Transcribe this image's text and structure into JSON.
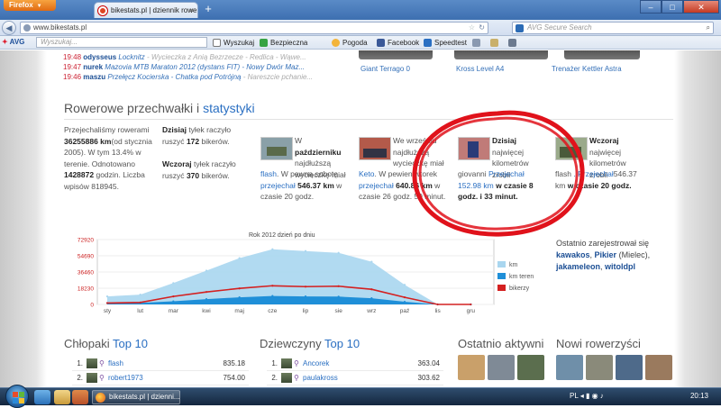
{
  "browser": {
    "menu_label": "Firefox",
    "tab_title": "bikestats.pl | dziennik rowerowy, blogi - ...",
    "url": "www.bikestats.pl",
    "search_placeholder": "AVG Secure Search",
    "new_tab_symbol": "+"
  },
  "toolbar": {
    "avg_label": "AVG",
    "search_placeholder": "Wyszukaj...",
    "items": [
      {
        "label": "Wyszukaj",
        "color": "#2d5ea8"
      },
      {
        "label": "Bezpieczna",
        "color": "#37a343"
      },
      {
        "label": "Pogoda",
        "color": "#f3b43a"
      },
      {
        "label": "Facebook",
        "color": "#3b5998"
      },
      {
        "label": "Speedtest",
        "color": "#2a6fc2"
      }
    ]
  },
  "activity": [
    {
      "time": "19:48",
      "user": "odysseus",
      "title": "Locknitz",
      "extra": "Wycieczka z Anią Bezrzecze - Redlica - Wąwe..."
    },
    {
      "time": "19:47",
      "user": "nurek",
      "title": "Mazovia MTB Maraton 2012 (dystans FIT) - Nowy Dwór Maz...",
      "extra": ""
    },
    {
      "time": "19:46",
      "user": "maszu",
      "title": "Przełęcz Kocierska - Chatka pod Potrójną",
      "extra": "Nareszcie pchanie..."
    }
  ],
  "top_bikes": [
    "Giant Terrago 0",
    "Kross Level A4",
    "Trenażer Kettler Astra"
  ],
  "section": {
    "title_prefix": "Rowerowe przechwałki i ",
    "title_link": "statystyki"
  },
  "stats": {
    "intro": [
      "Przejechaliśmy rowerami",
      "36255886 km",
      "(od stycznia 2005). W tym 13.4% w terenie. Odnotowano",
      "1428872",
      "godzin. Liczba wpisów 818945."
    ],
    "today_tile": [
      "Dzisiaj",
      "tyłek raczyło ruszyć",
      "172",
      "bikerów."
    ],
    "yesterday_tile": [
      "Wczoraj",
      "tyłek raczyło ruszyć",
      "370",
      "bikerów."
    ],
    "october": [
      "W",
      "październiku",
      "najdłuższą wycieczkę miał",
      "flash",
      ". W pewną sobotę",
      "przejechał",
      "546.37 km",
      "w czasie 20 godz."
    ],
    "week": [
      "We wrześniu",
      "najdłuższą wycieczkę miał",
      "Keto",
      ". W pewien wtorek",
      "przejechał",
      "640.86 km",
      "w czasie 26 godz. 50 minut."
    ],
    "today_longest": [
      "Dzisiaj",
      "najwięcej kilometrów zrobił",
      "giovanni",
      "Przejechał",
      "152.98 km",
      "w czasie 8 godz. i 33 minut."
    ],
    "yesterday_longest": [
      "Wczoraj",
      "najwięcej kilometrów zrobił",
      "flash",
      ". Przejechał",
      "546.37 km",
      "w czasie 20 godz."
    ]
  },
  "recent_registered": {
    "text": "Ostatnio zarejestrował się",
    "users": [
      "kawakos",
      "Pikier",
      "(Mielec),",
      "jakameleon",
      "witoldpl"
    ]
  },
  "chart_data": {
    "type": "area",
    "title": "Rok 2012 dzień po dniu",
    "categories": [
      "sty",
      "lut",
      "mar",
      "kwi",
      "maj",
      "cze",
      "lip",
      "sie",
      "wrz",
      "paź",
      "lis",
      "gru"
    ],
    "yticks": [
      0,
      18230,
      36460,
      54690,
      72920
    ],
    "ylim": [
      0,
      72920
    ],
    "series": [
      {
        "name": "km",
        "color": "#a9d6ef",
        "values": [
          9000,
          11000,
          24000,
          38000,
          52000,
          62000,
          60000,
          58000,
          48000,
          22000,
          0,
          0
        ]
      },
      {
        "name": "km teren",
        "color": "#1f8fd8",
        "values": [
          1500,
          1800,
          3500,
          6000,
          8000,
          9500,
          9000,
          8800,
          7000,
          3000,
          0,
          0
        ]
      },
      {
        "name": "bikerzy",
        "color": "#d42020",
        "values": [
          1600,
          2200,
          9000,
          14000,
          18000,
          21000,
          20000,
          20500,
          17000,
          8000,
          0,
          0
        ]
      }
    ],
    "legend_position": "right"
  },
  "bottom": {
    "boys_prefix": "Chłopaki ",
    "boys_link": "Top 10",
    "girls_prefix": "Dziewczyny ",
    "girls_link": "Top 10",
    "active": "Ostatnio aktywni",
    "new_riders": "Nowi rowerzyści",
    "boys": [
      {
        "rank": "1.",
        "name": "flash",
        "km": "835.18"
      },
      {
        "rank": "2.",
        "name": "robert1973",
        "km": "754.00"
      }
    ],
    "girls": [
      {
        "rank": "1.",
        "name": "Ancorek",
        "km": "363.04"
      },
      {
        "rank": "2.",
        "name": "paulakross",
        "km": "303.62"
      }
    ]
  },
  "taskbar": {
    "app_label": "bikestats.pl | dzienni...",
    "lang": "PL",
    "clock": "20:13"
  }
}
